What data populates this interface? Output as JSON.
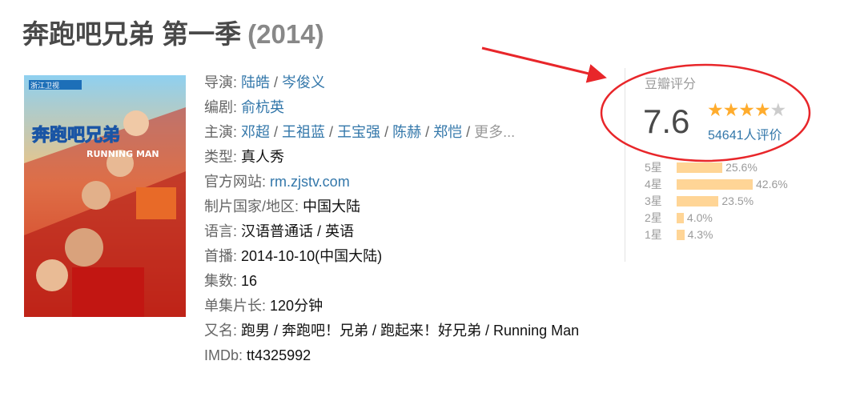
{
  "title": {
    "name": "奔跑吧兄弟 第一季",
    "year": "(2014)"
  },
  "poster": {
    "logo_text": "浙江卫视",
    "title_cn": "奔跑吧兄弟",
    "title_en": "RUNNING MAN"
  },
  "info": {
    "director": {
      "label": "导演:",
      "values": [
        "陆皓",
        "岑俊义"
      ]
    },
    "writer": {
      "label": "编剧:",
      "values": [
        "俞杭英"
      ]
    },
    "cast": {
      "label": "主演:",
      "values": [
        "邓超",
        "王祖蓝",
        "王宝强",
        "陈赫",
        "郑恺"
      ],
      "more": "更多..."
    },
    "genre": {
      "label": "类型:",
      "value": "真人秀"
    },
    "website": {
      "label": "官方网站:",
      "value": "rm.zjstv.com"
    },
    "country": {
      "label": "制片国家/地区:",
      "value": "中国大陆"
    },
    "language": {
      "label": "语言:",
      "value": "汉语普通话 / 英语"
    },
    "premiere": {
      "label": "首播:",
      "value": "2014-10-10(中国大陆)"
    },
    "episodes": {
      "label": "集数:",
      "value": "16"
    },
    "runtime": {
      "label": "单集片长:",
      "value": "120分钟"
    },
    "aka": {
      "label": "又名:",
      "value": "跑男 / 奔跑吧！兄弟 / 跑起来！好兄弟 / Running Man"
    },
    "imdb": {
      "label": "IMDb:",
      "value": "tt4325992"
    }
  },
  "rating": {
    "title": "豆瓣评分",
    "score": "7.6",
    "stars": 4,
    "votes": "54641人评价",
    "distribution": [
      {
        "label": "5星",
        "percent": 25.6,
        "text": "25.6%"
      },
      {
        "label": "4星",
        "percent": 42.6,
        "text": "42.6%"
      },
      {
        "label": "3星",
        "percent": 23.5,
        "text": "23.5%"
      },
      {
        "label": "2星",
        "percent": 4.0,
        "text": "4.0%"
      },
      {
        "label": "1星",
        "percent": 4.3,
        "text": "4.3%"
      }
    ]
  },
  "annotation": {
    "color": "#e8262a"
  }
}
